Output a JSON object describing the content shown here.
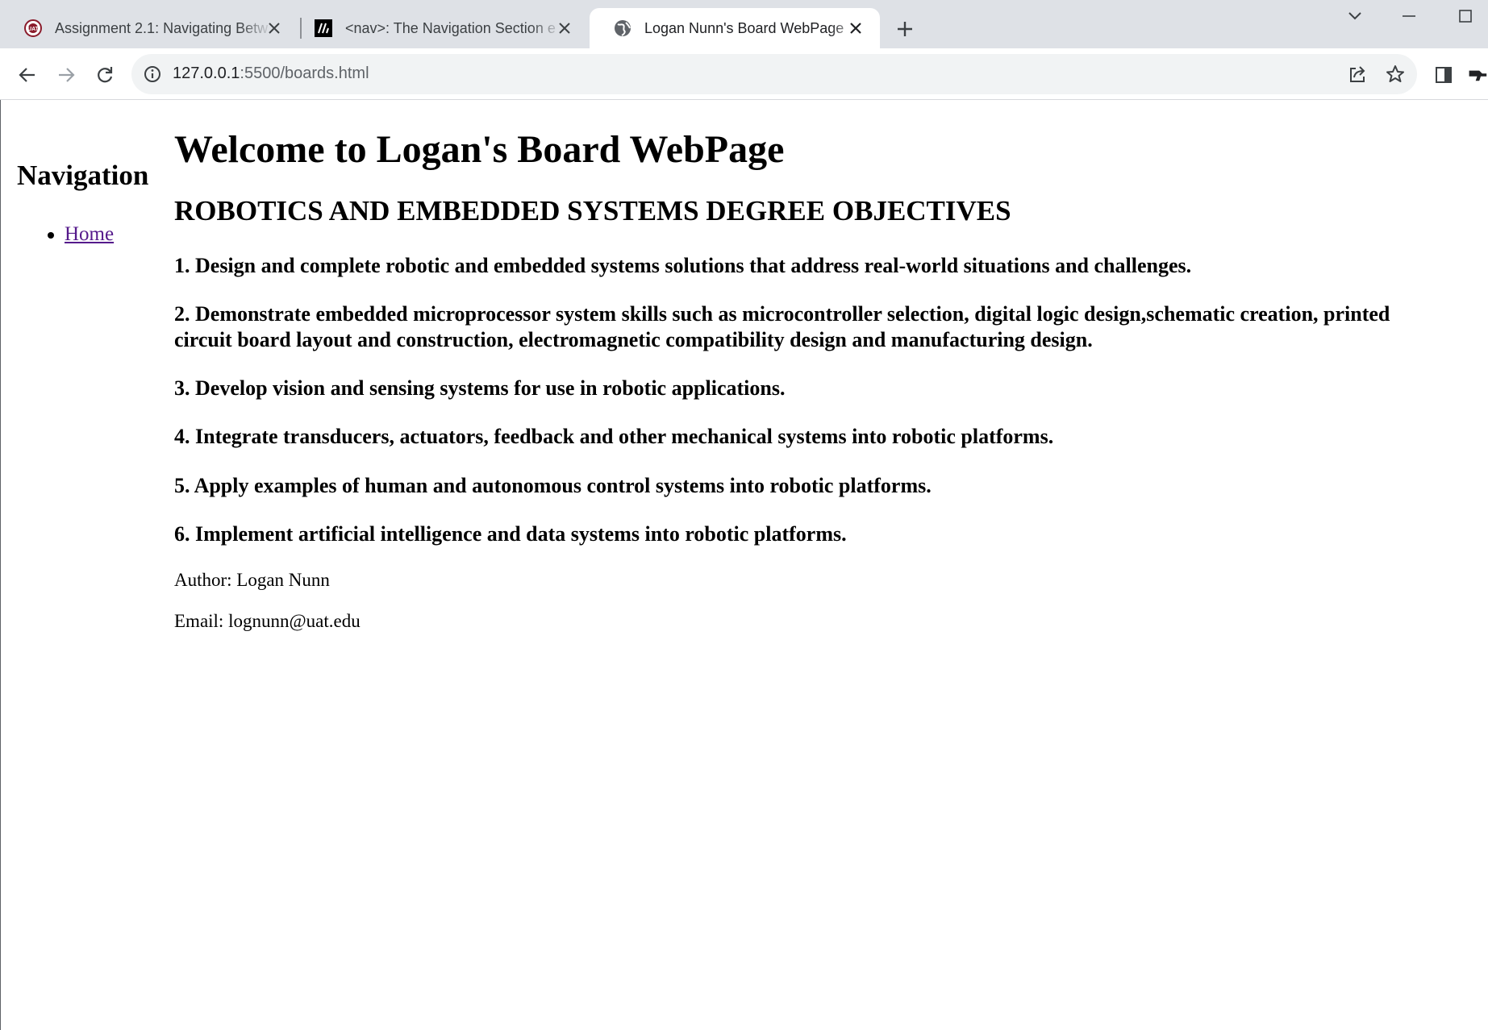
{
  "browser": {
    "tabs": [
      {
        "title": "Assignment 2.1: Navigating Betw",
        "favicon": "uat-logo-icon",
        "active": false
      },
      {
        "title": "<nav>: The Navigation Section e",
        "favicon": "mdn-logo-icon",
        "active": false
      },
      {
        "title": "Logan Nunn's Board WebPage",
        "favicon": "globe-icon",
        "active": true
      }
    ],
    "address_bar": {
      "host": "127.0.0.1",
      "rest": ":5500/boards.html"
    }
  },
  "page": {
    "sidebar": {
      "title": "Navigation",
      "links": [
        {
          "label": "Home"
        }
      ]
    },
    "heading": "Welcome to Logan's Board WebPage",
    "subheading": "ROBOTICS AND EMBEDDED SYSTEMS DEGREE OBJECTIVES",
    "objectives": [
      "1. Design and complete robotic and embedded systems solutions that address real-world situations and challenges.",
      "2. Demonstrate embedded microprocessor system skills such as microcontroller selection, digital logic design,schematic creation, printed",
      "circuit board layout and construction, electromagnetic compatibility design and manufacturing design.",
      "3. Develop vision and sensing systems for use in robotic applications.",
      "4. Integrate transducers, actuators, feedback and other mechanical systems into robotic platforms.",
      "5. Apply examples of human and autonomous control systems into robotic platforms.",
      "6. Implement artificial intelligence and data systems into robotic platforms."
    ],
    "author": "Author: Logan Nunn",
    "email": "Email: lognunn@uat.edu"
  },
  "colors": {
    "tabstrip": "#dee1e6",
    "omnibox": "#f1f3f4",
    "visited_link": "#551a8b"
  }
}
